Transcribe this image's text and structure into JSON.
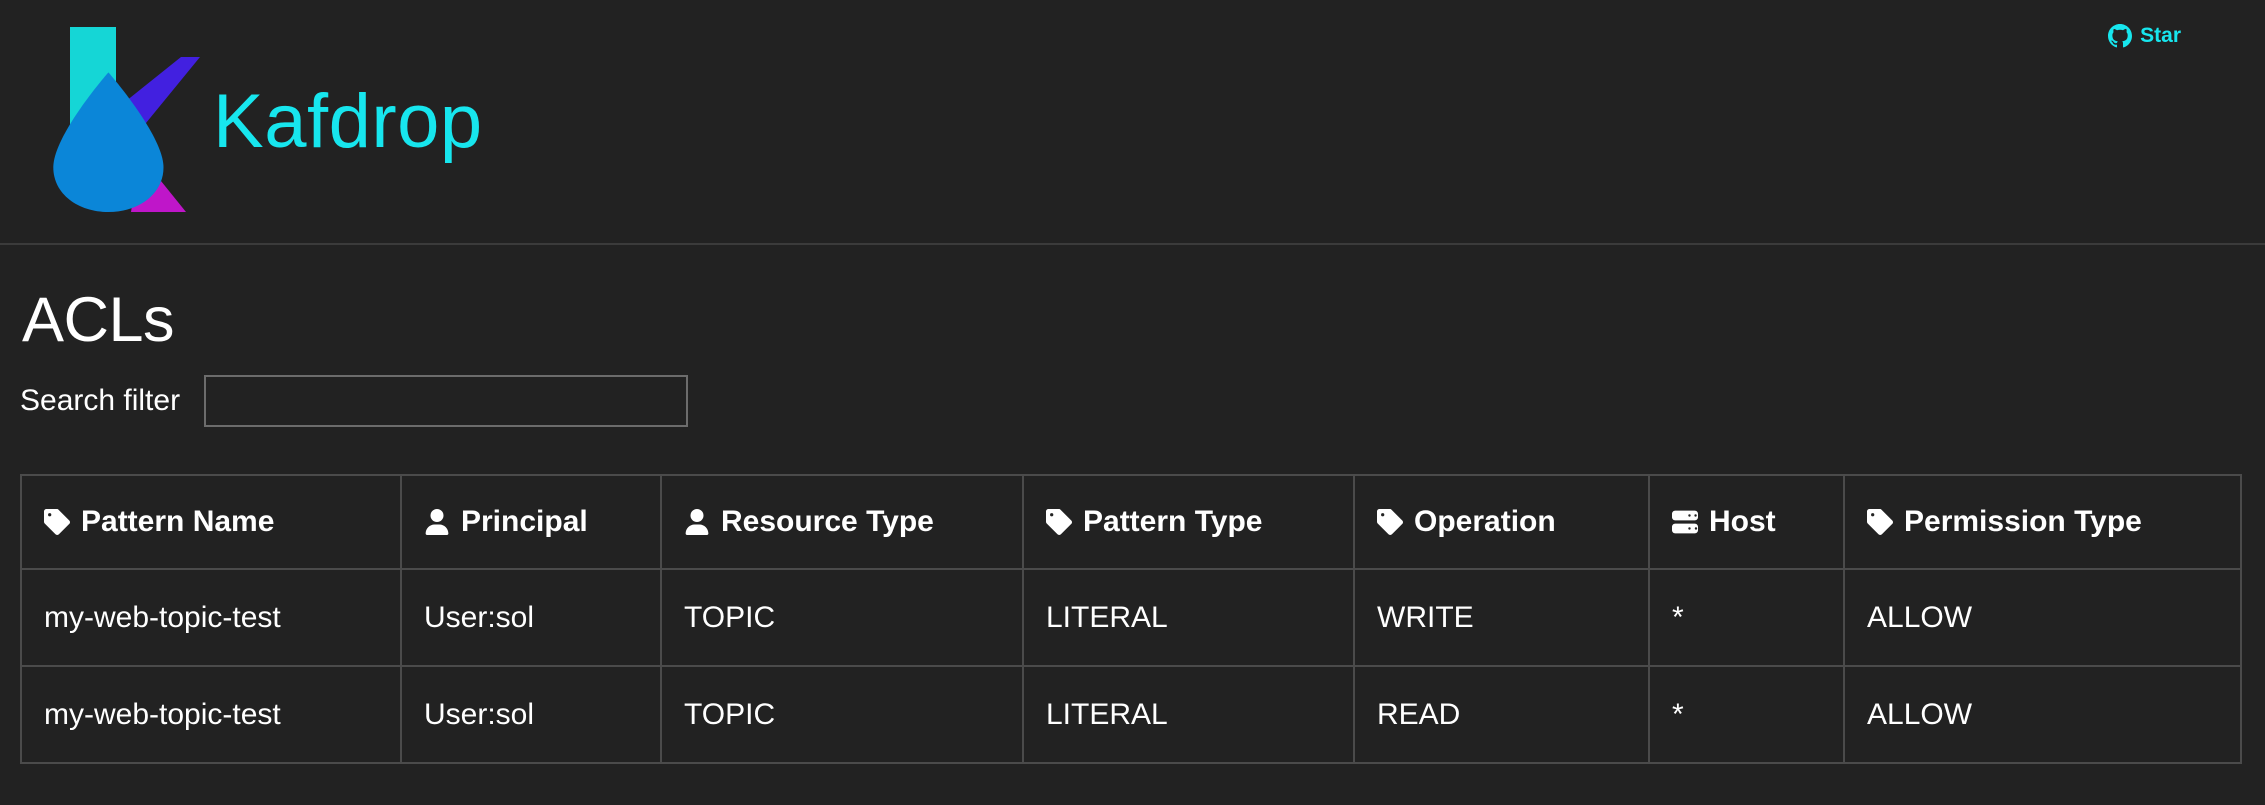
{
  "navbar": {
    "brand_name": "Kafdrop",
    "brand_logo_icon": "kafdrop-droplet-k-logo",
    "github_star": {
      "label": "Star",
      "icon": "github-mark-icon"
    }
  },
  "page": {
    "title": "ACLs",
    "search": {
      "label": "Search filter",
      "value": "",
      "placeholder": ""
    }
  },
  "table": {
    "columns": [
      {
        "label": "Pattern Name",
        "icon": "tag-icon"
      },
      {
        "label": "Principal",
        "icon": "user-icon"
      },
      {
        "label": "Resource Type",
        "icon": "user-icon"
      },
      {
        "label": "Pattern Type",
        "icon": "tag-icon"
      },
      {
        "label": "Operation",
        "icon": "tag-icon"
      },
      {
        "label": "Host",
        "icon": "server-icon"
      },
      {
        "label": "Permission Type",
        "icon": "tag-icon"
      }
    ],
    "rows": [
      {
        "pattern_name": "my-web-topic-test",
        "principal": "User:sol",
        "resource_type": "TOPIC",
        "pattern_type": "LITERAL",
        "operation": "WRITE",
        "host": "*",
        "permission_type": "ALLOW"
      },
      {
        "pattern_name": "my-web-topic-test",
        "principal": "User:sol",
        "resource_type": "TOPIC",
        "pattern_type": "LITERAL",
        "operation": "READ",
        "host": "*",
        "permission_type": "ALLOW"
      }
    ]
  },
  "colors": {
    "background": "#222222",
    "accent_cyan": "#17e6ee",
    "logo_teal": "#15d6d6",
    "logo_blue": "#0b86d8",
    "logo_violet": "#4220e0",
    "logo_magenta": "#bf16c9",
    "border": "#4b4b4b",
    "input_border": "#6c6c6c",
    "text": "#ffffff"
  }
}
